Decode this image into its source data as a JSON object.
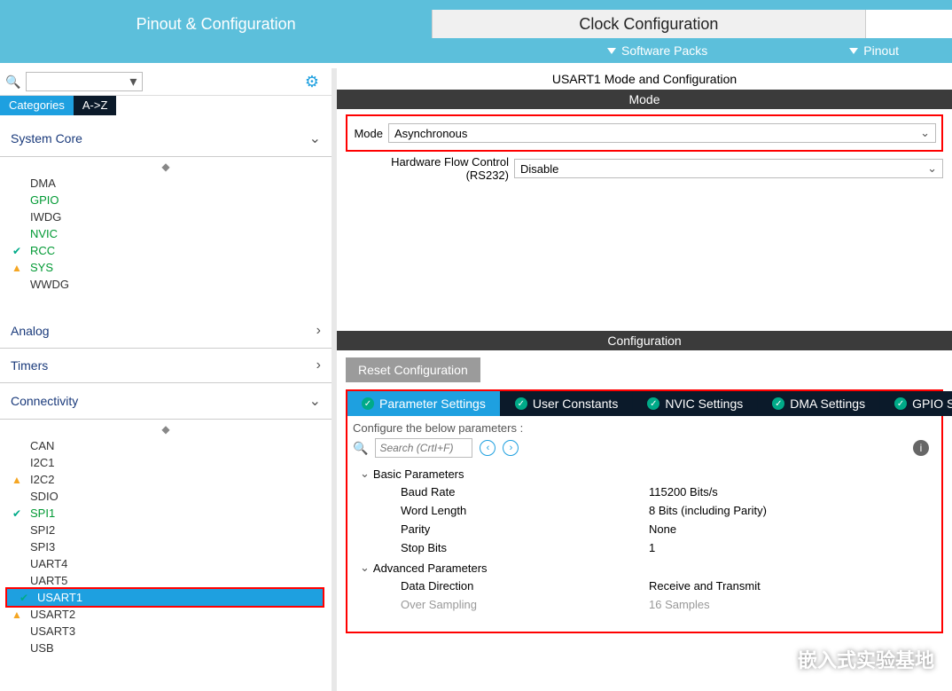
{
  "tabs": {
    "primary": [
      "Pinout & Configuration",
      "Clock Configuration",
      ""
    ],
    "sub": [
      "Software Packs",
      "Pinout"
    ]
  },
  "cat_tabs": [
    "Categories",
    "A->Z"
  ],
  "groups": {
    "system_core": {
      "label": "System Core",
      "items": [
        {
          "name": "DMA"
        },
        {
          "name": "GPIO",
          "color": "green"
        },
        {
          "name": "IWDG"
        },
        {
          "name": "NVIC",
          "color": "green"
        },
        {
          "name": "RCC",
          "color": "green",
          "status": "check"
        },
        {
          "name": "SYS",
          "color": "green",
          "status": "warn"
        },
        {
          "name": "WWDG"
        }
      ]
    },
    "analog": {
      "label": "Analog"
    },
    "timers": {
      "label": "Timers"
    },
    "connectivity": {
      "label": "Connectivity",
      "items": [
        {
          "name": "CAN"
        },
        {
          "name": "I2C1"
        },
        {
          "name": "I2C2",
          "status": "warn"
        },
        {
          "name": "SDIO"
        },
        {
          "name": "SPI1",
          "color": "green",
          "status": "check"
        },
        {
          "name": "SPI2"
        },
        {
          "name": "SPI3"
        },
        {
          "name": "UART4"
        },
        {
          "name": "UART5"
        },
        {
          "name": "USART1",
          "selected": true,
          "status": "ok-circle"
        },
        {
          "name": "USART2",
          "status": "warn"
        },
        {
          "name": "USART3"
        },
        {
          "name": "USB"
        }
      ]
    }
  },
  "right": {
    "title": "USART1 Mode and Configuration",
    "mode_header": "Mode",
    "mode_label": "Mode",
    "mode_value": "Asynchronous",
    "hwflow_label": "Hardware Flow Control (RS232)",
    "hwflow_value": "Disable",
    "config_header": "Configuration",
    "reset_btn": "Reset Configuration",
    "config_tabs": [
      "Parameter Settings",
      "User Constants",
      "NVIC Settings",
      "DMA Settings",
      "GPIO Settings"
    ],
    "config_caption": "Configure the below parameters :",
    "search_placeholder": "Search (CrtI+F)",
    "param_groups": [
      {
        "label": "Basic Parameters",
        "rows": [
          {
            "label": "Baud Rate",
            "value": "115200 Bits/s"
          },
          {
            "label": "Word Length",
            "value": "8 Bits (including Parity)"
          },
          {
            "label": "Parity",
            "value": "None"
          },
          {
            "label": "Stop Bits",
            "value": "1"
          }
        ]
      },
      {
        "label": "Advanced Parameters",
        "rows": [
          {
            "label": "Data Direction",
            "value": "Receive and Transmit"
          },
          {
            "label": "Over Sampling",
            "value": "16 Samples",
            "grey": true
          }
        ]
      }
    ]
  },
  "watermark": "嵌入式实验基地"
}
